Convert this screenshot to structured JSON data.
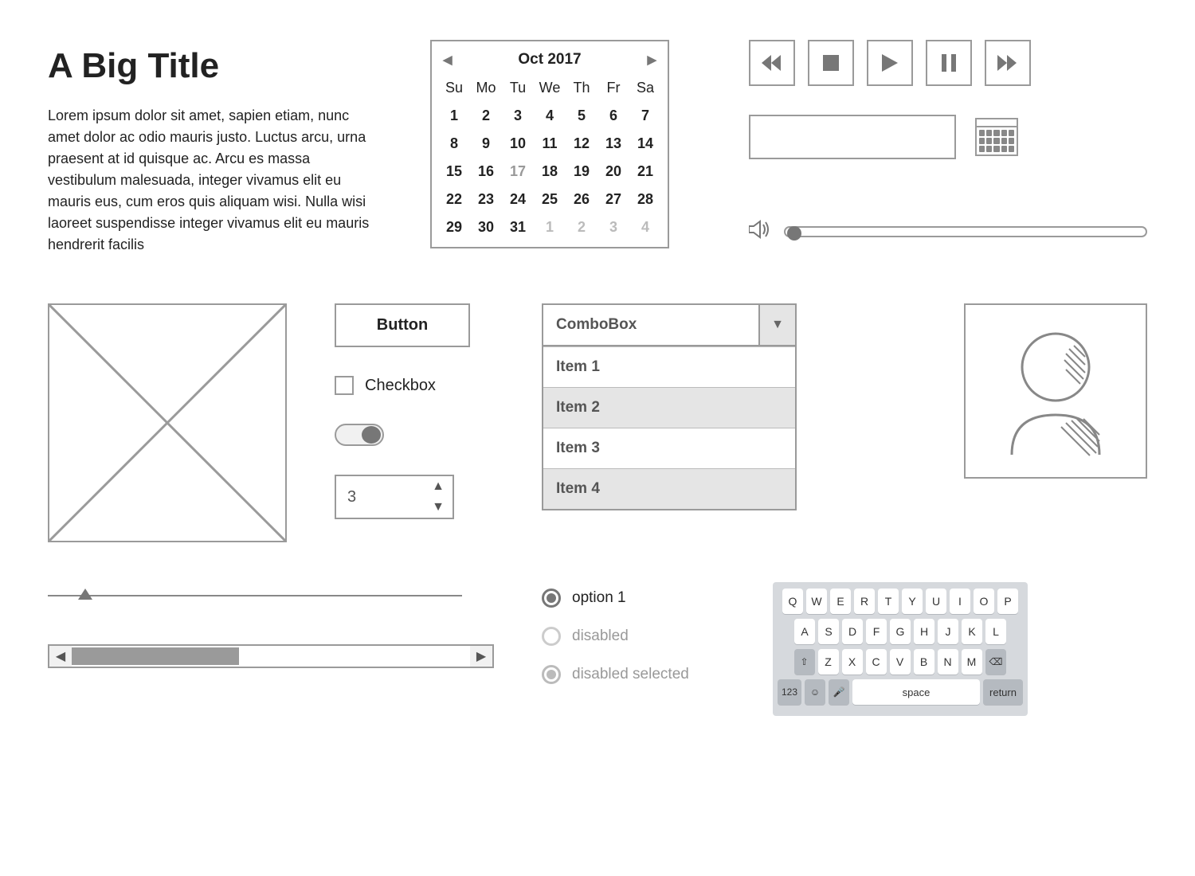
{
  "title": "A Big Title",
  "lorem": "Lorem ipsum dolor sit amet, sapien etiam, nunc amet dolor ac odio mauris justo. Luctus arcu, urna praesent at id quisque ac. Arcu es massa vestibulum malesuada, integer vivamus elit eu mauris eus, cum eros quis aliquam wisi. Nulla wisi laoreet suspendisse integer vivamus elit eu mauris hendrerit facilis",
  "calendar": {
    "month_label": "Oct  2017",
    "dow": [
      "Su",
      "Mo",
      "Tu",
      "We",
      "Th",
      "Fr",
      "Sa"
    ],
    "days": [
      {
        "n": "1"
      },
      {
        "n": "2"
      },
      {
        "n": "3"
      },
      {
        "n": "4"
      },
      {
        "n": "5"
      },
      {
        "n": "6"
      },
      {
        "n": "7"
      },
      {
        "n": "8"
      },
      {
        "n": "9"
      },
      {
        "n": "10"
      },
      {
        "n": "11"
      },
      {
        "n": "12"
      },
      {
        "n": "13"
      },
      {
        "n": "14"
      },
      {
        "n": "15"
      },
      {
        "n": "16"
      },
      {
        "n": "17",
        "today": true
      },
      {
        "n": "18"
      },
      {
        "n": "19"
      },
      {
        "n": "20"
      },
      {
        "n": "21"
      },
      {
        "n": "22"
      },
      {
        "n": "23"
      },
      {
        "n": "24"
      },
      {
        "n": "25"
      },
      {
        "n": "26"
      },
      {
        "n": "27"
      },
      {
        "n": "28"
      },
      {
        "n": "29"
      },
      {
        "n": "30"
      },
      {
        "n": "31"
      },
      {
        "n": "1",
        "other": true
      },
      {
        "n": "2",
        "other": true
      },
      {
        "n": "3",
        "other": true
      },
      {
        "n": "4",
        "other": true
      }
    ]
  },
  "button_label": "Button",
  "checkbox_label": "Checkbox",
  "stepper_value": "3",
  "combo": {
    "label": "ComboBox",
    "items": [
      "Item 1",
      "Item 2",
      "Item 3",
      "Item 4"
    ]
  },
  "radios": {
    "opt1": "option 1",
    "opt2": "disabled",
    "opt3": "disabled selected"
  },
  "keyboard": {
    "row1": [
      "Q",
      "W",
      "E",
      "R",
      "T",
      "Y",
      "U",
      "I",
      "O",
      "P"
    ],
    "row2": [
      "A",
      "S",
      "D",
      "F",
      "G",
      "H",
      "J",
      "K",
      "L"
    ],
    "row3": [
      "Z",
      "X",
      "C",
      "V",
      "B",
      "N",
      "M"
    ],
    "num_key": "123",
    "space_key": "space",
    "return_key": "return"
  }
}
